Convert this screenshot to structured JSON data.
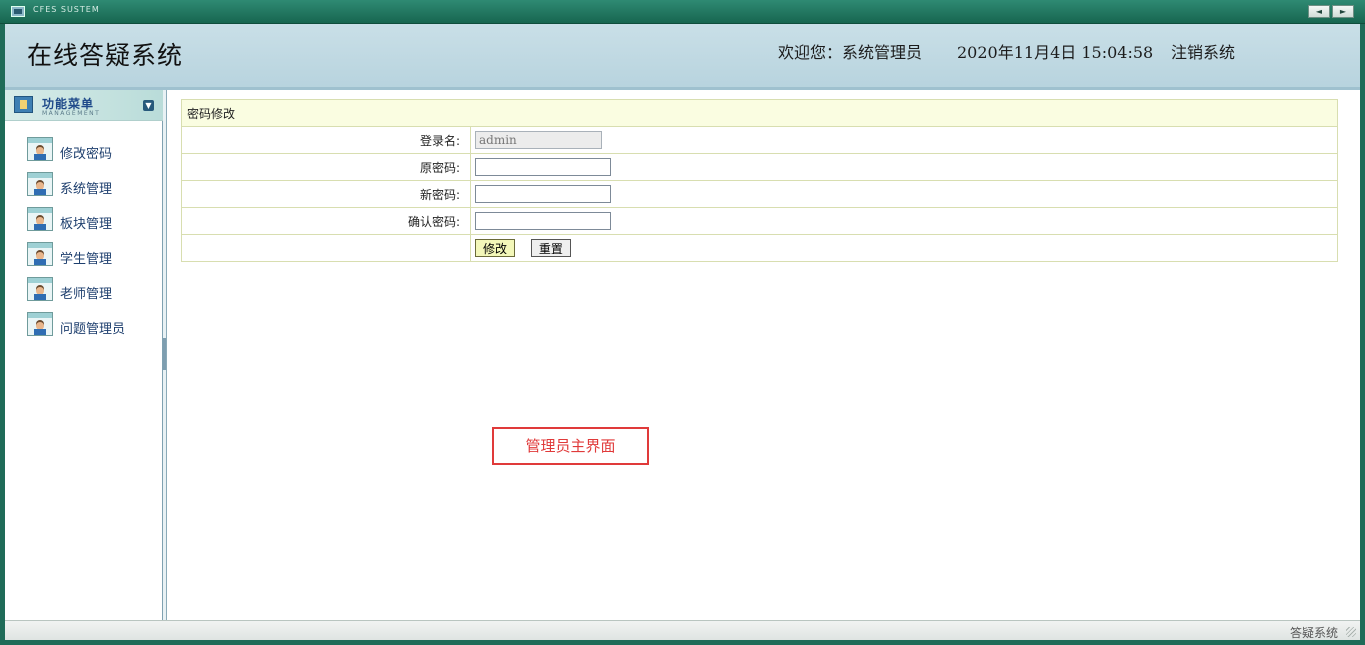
{
  "window": {
    "system_title": "CFES SUSTEM",
    "nav_prev": "◄",
    "nav_next": "►",
    "icon": "window-icon"
  },
  "header": {
    "app_title": "在线答疑系统",
    "welcome": "欢迎您：系统管理员",
    "datetime": "2020年11月4日 15:04:58",
    "logout": "注销系统"
  },
  "sidebar": {
    "title": "功能菜单",
    "subtitle": "MANAGEMENT",
    "collapse_icon": "chevron-down-icon",
    "items": [
      {
        "label": "修改密码",
        "icon": "user-card-icon"
      },
      {
        "label": "系统管理",
        "icon": "user-card-icon"
      },
      {
        "label": "板块管理",
        "icon": "user-card-icon"
      },
      {
        "label": "学生管理",
        "icon": "user-card-icon"
      },
      {
        "label": "老师管理",
        "icon": "user-card-icon"
      },
      {
        "label": "问题管理员",
        "icon": "user-card-icon"
      }
    ]
  },
  "form": {
    "title": "密码修改",
    "fields": {
      "username": {
        "label": "登录名:",
        "value": "admin"
      },
      "old_password": {
        "label": "原密码:",
        "value": ""
      },
      "new_password": {
        "label": "新密码:",
        "value": ""
      },
      "confirm_password": {
        "label": "确认密码:",
        "value": ""
      }
    },
    "submit_label": "修改",
    "reset_label": "重置"
  },
  "annotation": {
    "text": "管理员主界面",
    "color": "#e03a3a"
  },
  "statusbar": {
    "text": "答疑系统"
  },
  "colors": {
    "frame": "#1f6b58",
    "header_bg": "#c1d9e2",
    "menu_text": "#1e3f6e",
    "form_title_bg": "#fafde1"
  }
}
